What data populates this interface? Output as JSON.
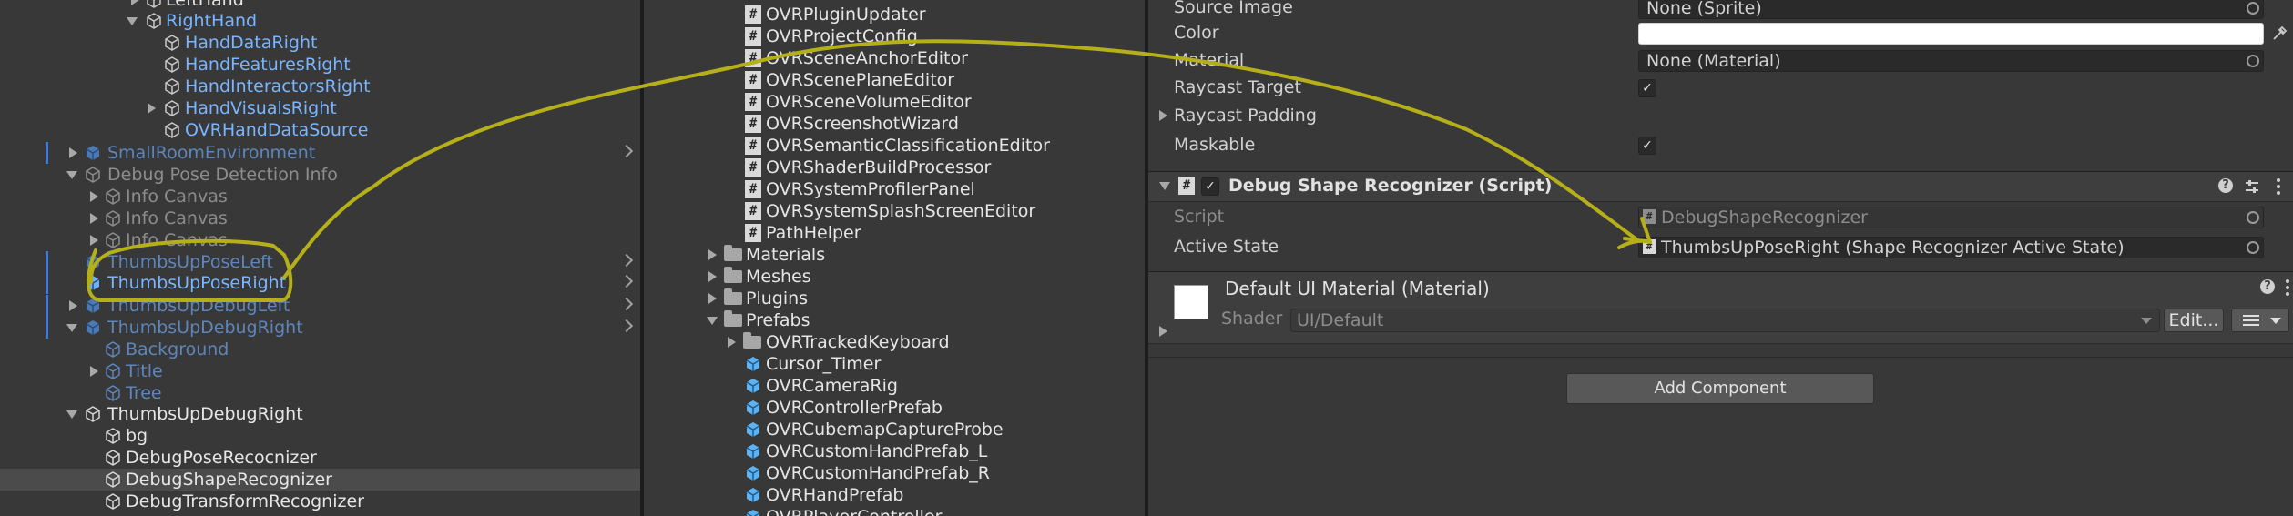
{
  "hierarchy": {
    "items": [
      {
        "label": "LeftHand"
      },
      {
        "label": "RightHand"
      },
      {
        "label": "HandDataRight"
      },
      {
        "label": "HandFeaturesRight"
      },
      {
        "label": "HandInteractorsRight"
      },
      {
        "label": "HandVisualsRight"
      },
      {
        "label": "OVRHandDataSource"
      },
      {
        "label": "SmallRoomEnvironment"
      },
      {
        "label": "Debug Pose Detection Info"
      },
      {
        "label": "Info Canvas"
      },
      {
        "label": "Info Canvas"
      },
      {
        "label": "Info Canvas"
      },
      {
        "label": "ThumbsUpPoseLeft"
      },
      {
        "label": "ThumbsUpPoseRight"
      },
      {
        "label": "ThumbsUpDebugLeft"
      },
      {
        "label": "ThumbsUpDebugRight"
      },
      {
        "label": "Background"
      },
      {
        "label": "Title"
      },
      {
        "label": "Tree"
      },
      {
        "label": "ThumbsUpDebugRight"
      },
      {
        "label": "bg"
      },
      {
        "label": "DebugPoseRecocnizer"
      },
      {
        "label": "DebugShapeRecognizer"
      },
      {
        "label": "DebugTransformRecognizer"
      }
    ]
  },
  "project": {
    "items": [
      {
        "label": "OVRPluginUpdater"
      },
      {
        "label": "OVRProjectConfig"
      },
      {
        "label": "OVRSceneAnchorEditor"
      },
      {
        "label": "OVRScenePlaneEditor"
      },
      {
        "label": "OVRSceneVolumeEditor"
      },
      {
        "label": "OVRScreenshotWizard"
      },
      {
        "label": "OVRSemanticClassificationEditor"
      },
      {
        "label": "OVRShaderBuildProcessor"
      },
      {
        "label": "OVRSystemProfilerPanel"
      },
      {
        "label": "OVRSystemSplashScreenEditor"
      },
      {
        "label": "PathHelper"
      },
      {
        "label": "Materials"
      },
      {
        "label": "Meshes"
      },
      {
        "label": "Plugins"
      },
      {
        "label": "Prefabs"
      },
      {
        "label": "OVRTrackedKeyboard"
      },
      {
        "label": "Cursor_Timer"
      },
      {
        "label": "OVRCameraRig"
      },
      {
        "label": "OVRControllerPrefab"
      },
      {
        "label": "OVRCubemapCaptureProbe"
      },
      {
        "label": "OVRCustomHandPrefab_L"
      },
      {
        "label": "OVRCustomHandPrefab_R"
      },
      {
        "label": "OVRHandPrefab"
      },
      {
        "label": "OVRPlayerController"
      }
    ]
  },
  "inspector": {
    "image": {
      "source_image_label": "Source Image",
      "source_image_value": "None (Sprite)",
      "color_label": "Color",
      "color_value": "#ffffff",
      "material_label": "Material",
      "material_value": "None (Material)",
      "raycast_target_label": "Raycast Target",
      "raycast_target_checked": true,
      "raycast_padding_label": "Raycast Padding",
      "maskable_label": "Maskable",
      "maskable_checked": true
    },
    "component": {
      "title": "Debug Shape Recognizer (Script)",
      "script_label": "Script",
      "script_value": "DebugShapeRecognizer",
      "active_state_label": "Active State",
      "active_state_value": "ThumbsUpPoseRight (Shape Recognizer Active State)"
    },
    "material": {
      "title": "Default UI Material (Material)",
      "shader_label": "Shader",
      "shader_value": "UI/Default",
      "edit_label": "Edit..."
    },
    "add_component_label": "Add Component"
  },
  "icons": {
    "gameobject": "cube-icon",
    "prefab": "prefab-cube-icon",
    "script": "hash-script-icon",
    "folder": "folder-icon",
    "help": "question-icon",
    "presets": "sliders-icon",
    "menu": "kebab-icon",
    "picker": "eyedropper-icon",
    "object_picker": "target-circle-icon"
  },
  "annotations": {
    "color": "#b5b019"
  }
}
